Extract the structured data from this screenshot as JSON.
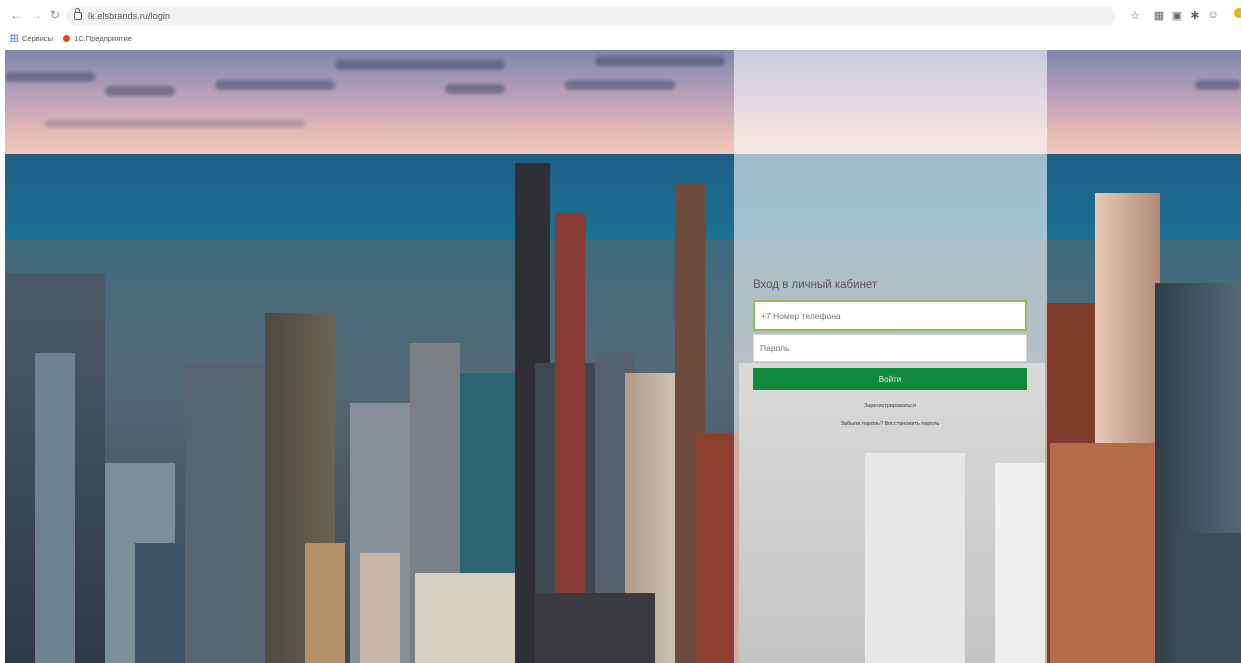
{
  "browser": {
    "url": "lk.elsbrands.ru/login",
    "bookmarks": [
      {
        "label": "Сервисы"
      },
      {
        "label": "1С:Предприятие"
      }
    ],
    "icons": [
      "back-icon",
      "forward-icon",
      "reload-icon",
      "lock-icon",
      "star-icon",
      "extension-icon",
      "extension-icon-2",
      "bookmark-icon",
      "account-icon",
      "profile-avatar"
    ]
  },
  "login": {
    "title": "Вход в личный кабинет",
    "phone_placeholder": "+7 Номер телефона",
    "password_placeholder": "Пароль",
    "submit_label": "Войти",
    "register_link": "Зарегистрироваться",
    "forgot_link": "Забыли пароль? Восстановить пароль"
  },
  "colors": {
    "accent": "#0f8a3a",
    "focus_border": "#8cbe5a"
  }
}
